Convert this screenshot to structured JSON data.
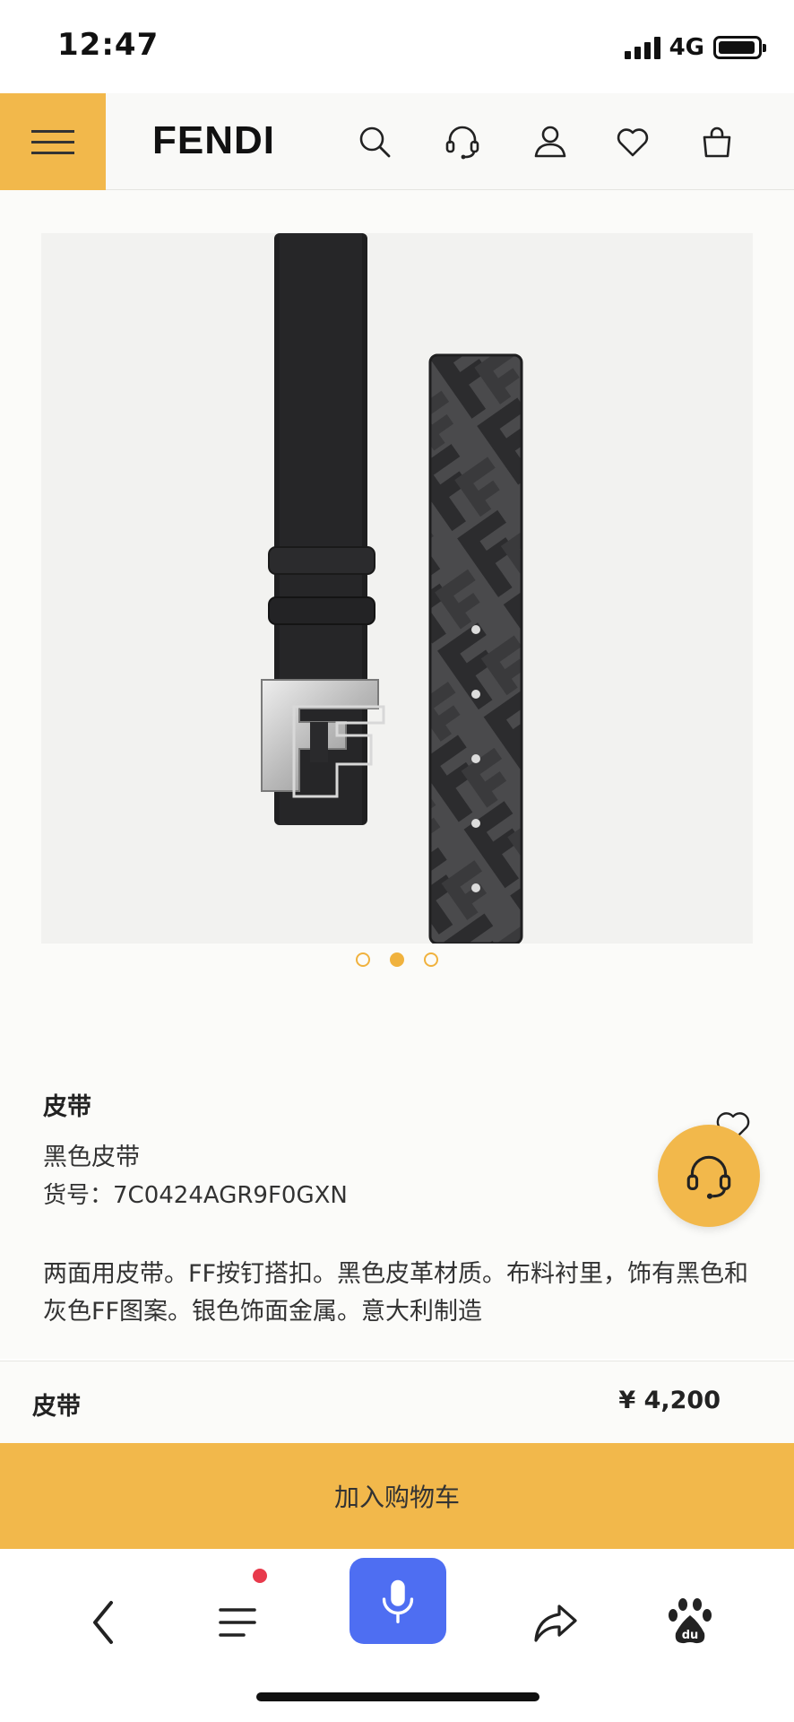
{
  "status": {
    "time": "12:47",
    "network": "4G",
    "battery_level": 0.95
  },
  "header": {
    "logo": "FENDI",
    "icons": [
      "menu-icon",
      "search-icon",
      "customer-service-icon",
      "account-icon",
      "wishlist-icon",
      "shopping-bag-icon"
    ]
  },
  "gallery": {
    "slide_count": 3,
    "active_slide": 2
  },
  "product": {
    "title": "皮带",
    "subtitle": "黑色皮带",
    "sku": "货号：7C0424AGR9F0GXN",
    "description": "两面用皮带。FF按钉搭扣。黑色皮革材质。布料衬里，饰有黑色和灰色FF图案。银色饰面金属。意大利制造"
  },
  "price_bar": {
    "label": "皮带",
    "price": "¥  4,200"
  },
  "cart": {
    "label": "加入购物车"
  },
  "bottom_nav": {
    "icons": [
      "back-icon",
      "menu-list-icon",
      "microphone-icon",
      "share-icon",
      "baidu-icon"
    ],
    "notification": true
  },
  "colors": {
    "accent": "#f2b84b",
    "mic_button": "#4e6ef2",
    "notification_dot": "#e83a4c"
  }
}
